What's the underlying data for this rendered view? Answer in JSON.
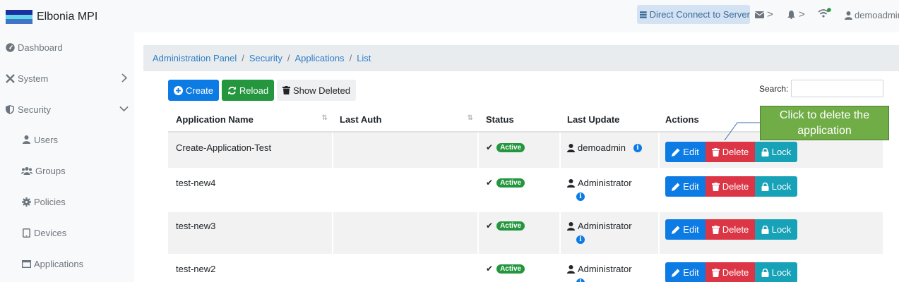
{
  "app": {
    "title": "Elbonia MPI",
    "flag_colors": [
      "#1b2fa3",
      "#62d5e6",
      "#3f74c8"
    ]
  },
  "header": {
    "direct_connect": "Direct Connect to Server",
    "chevron_mail": ">",
    "chevron_bell": ">",
    "user": "demoadmin"
  },
  "sidebar": {
    "items": [
      {
        "label": "Dashboard",
        "icon": "dashboard-icon"
      },
      {
        "label": "System",
        "icon": "tools-icon",
        "chevron": "chevron-right-icon"
      },
      {
        "label": "Security",
        "icon": "shield-icon",
        "chevron": "chevron-down-icon"
      },
      {
        "label": "Users",
        "icon": "user-icon"
      },
      {
        "label": "Groups",
        "icon": "users-icon"
      },
      {
        "label": "Policies",
        "icon": "cog-icon"
      },
      {
        "label": "Devices",
        "icon": "tablet-icon"
      },
      {
        "label": "Applications",
        "icon": "window-icon"
      }
    ]
  },
  "breadcrumb": {
    "items": [
      "Administration Panel",
      "Security",
      "Applications",
      "List"
    ],
    "separator": "/"
  },
  "toolbar": {
    "create": "Create",
    "reload": "Reload",
    "show_deleted": "Show Deleted",
    "search_label": "Search:",
    "search_value": ""
  },
  "table": {
    "columns": [
      "Application Name",
      "Last Auth",
      "Status",
      "Last Update",
      "Actions"
    ],
    "sort_glyph": "⇅",
    "rows": [
      {
        "name": "Create-Application-Test",
        "last_auth": "",
        "status": "Active",
        "updated_by": "demoadmin"
      },
      {
        "name": "test-new4",
        "last_auth": "",
        "status": "Active",
        "updated_by": "Administrator"
      },
      {
        "name": "test-new3",
        "last_auth": "",
        "status": "Active",
        "updated_by": "Administrator"
      },
      {
        "name": "test-new2",
        "last_auth": "",
        "status": "Active",
        "updated_by": "Administrator"
      }
    ],
    "action_labels": {
      "edit": "Edit",
      "delete": "Delete",
      "lock": "Lock"
    },
    "info_glyph": "i",
    "check_glyph": "✔"
  },
  "callout": {
    "text": "Click to delete the application",
    "color": "#70ad47"
  },
  "colors": {
    "primary": "#0d7be4",
    "success": "#23963e",
    "danger": "#dc3545",
    "info": "#17a2b8"
  }
}
